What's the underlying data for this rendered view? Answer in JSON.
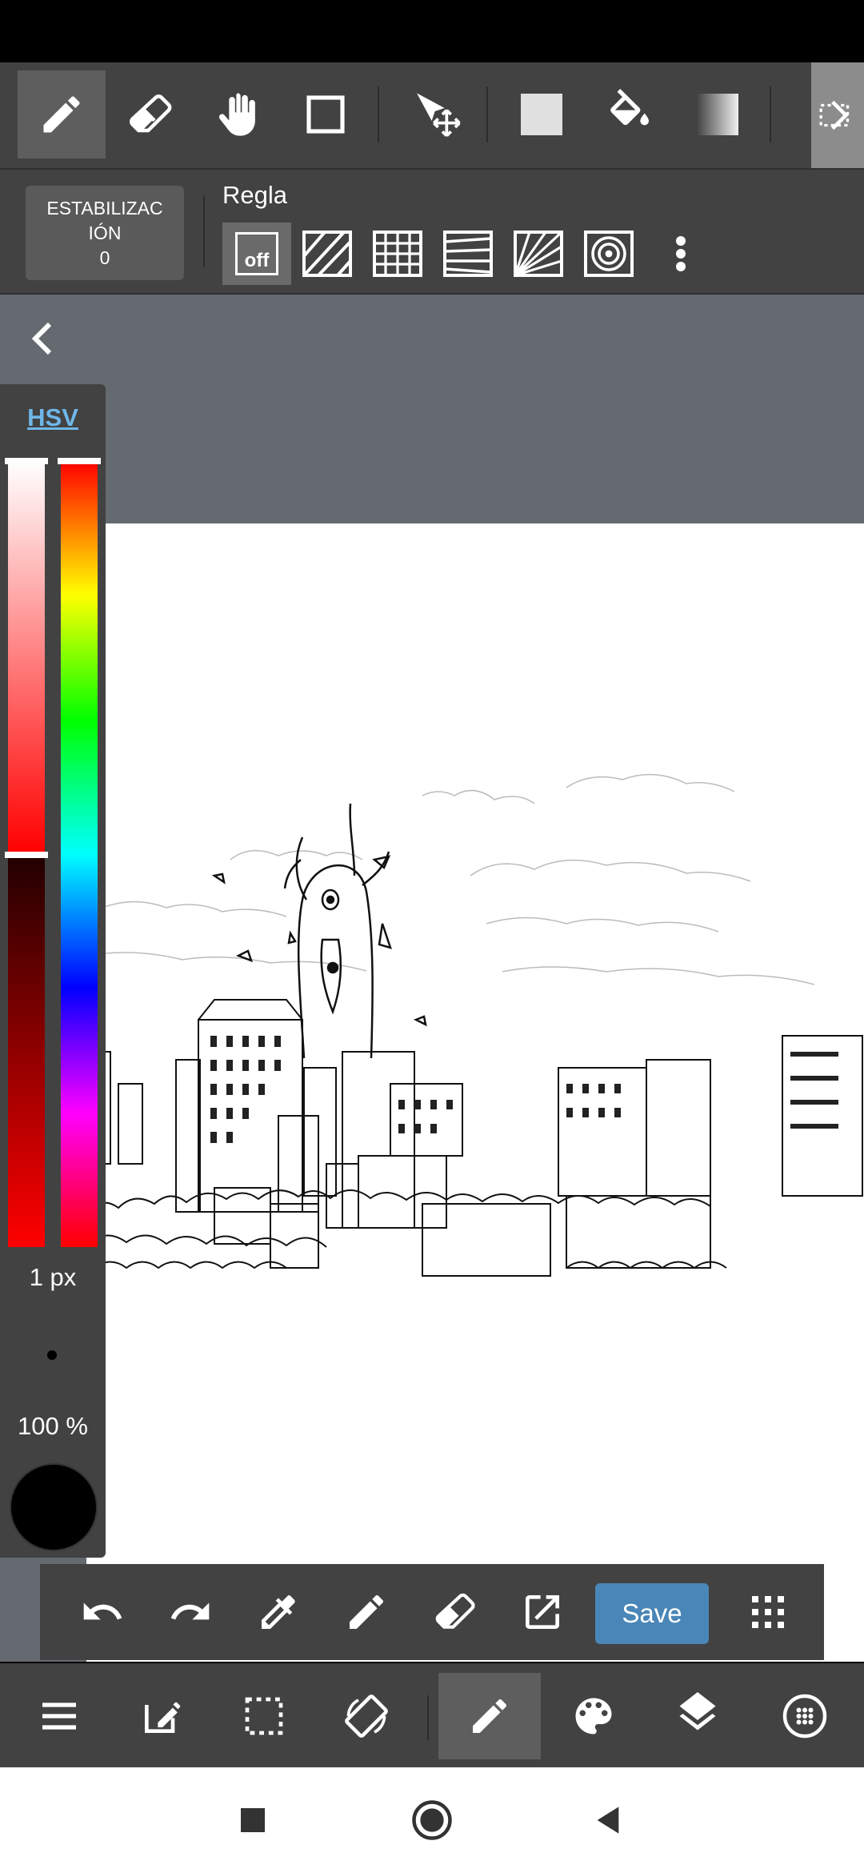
{
  "toolbar": {
    "tools": [
      "pen-icon",
      "eraser-icon",
      "hand-icon",
      "rectangle-icon",
      "move-icon",
      "fill-color-icon",
      "bucket-icon",
      "gradient-icon",
      "more-tools-icon"
    ]
  },
  "subtoolbar": {
    "stabilizer_line1": "ESTABILIZAC",
    "stabilizer_line2": "IÓN",
    "stabilizer_value": "0",
    "ruler_label": "Regla",
    "ruler_off": "off"
  },
  "color_panel": {
    "mode_tab": "HSV",
    "brush_size": "1 px",
    "opacity": "100 %",
    "current_color": "#000000"
  },
  "actions": {
    "save_label": "Save"
  },
  "colors": {
    "toolbar_bg": "#424242",
    "workspace_bg": "#656a70",
    "save_button": "#4a86b7",
    "hsv_tab": "#6fb6e8"
  }
}
